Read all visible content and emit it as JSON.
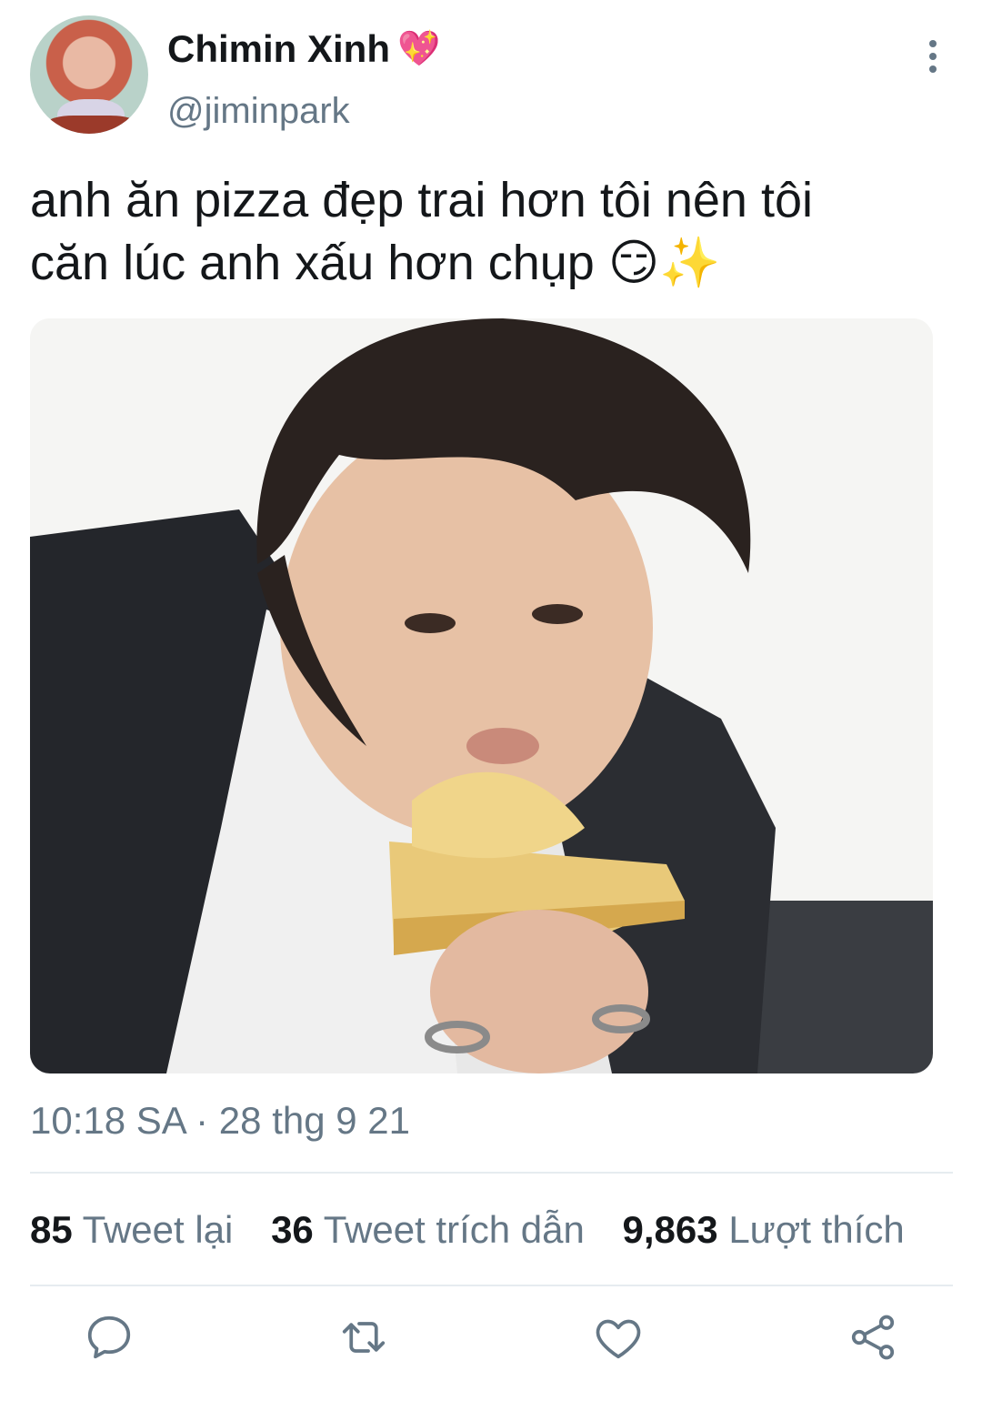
{
  "tweet": {
    "author": {
      "display_name": "Chimin Xinh",
      "name_emoji": "💖",
      "handle": "@jiminpark"
    },
    "text_line1": "anh ăn pizza đẹp trai hơn tôi nên tôi",
    "text_line2": "căn lúc anh xấu hơn chụp",
    "text_emojis": "😏✨",
    "timestamp": "10:18 SA · 28 thg 9 21",
    "stats": {
      "retweets_count": "85",
      "retweets_label": "Tweet lại",
      "quotes_count": "36",
      "quotes_label": "Tweet trích dẫn",
      "likes_count": "9,863",
      "likes_label": "Lượt thích"
    }
  },
  "icons": {
    "more": "more-vertical-icon",
    "reply": "reply-icon",
    "retweet": "retweet-icon",
    "like": "heart-icon",
    "share": "share-icon"
  },
  "colors": {
    "text_primary": "#14171a",
    "text_secondary": "#657786",
    "divider": "#e6ecf0"
  }
}
